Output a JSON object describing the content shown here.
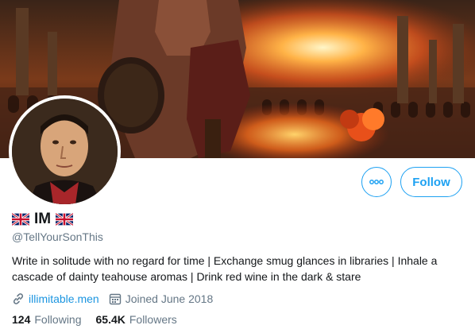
{
  "profile": {
    "display_name": "IM",
    "handle": "@TellYourSonThis",
    "bio": "Write in solitude with no regard for time | Exchange smug glances in libraries | Inhale a cascade of dainty teahouse aromas | Drink red wine in the dark & stare",
    "website": "illimitable.men",
    "joined": "Joined June 2018",
    "following_count": "124",
    "following_label": "Following",
    "followers_count": "65.4K",
    "followers_label": "Followers"
  },
  "actions": {
    "follow_label": "Follow",
    "more_icon": "more-horizontal-icon"
  },
  "icons": {
    "flag": "uk-flag-icon",
    "link": "link-icon",
    "calendar": "calendar-icon"
  },
  "colors": {
    "accent": "#1da1f2",
    "link": "#1b95e0",
    "secondary_text": "#657786",
    "primary_text": "#14171a"
  }
}
